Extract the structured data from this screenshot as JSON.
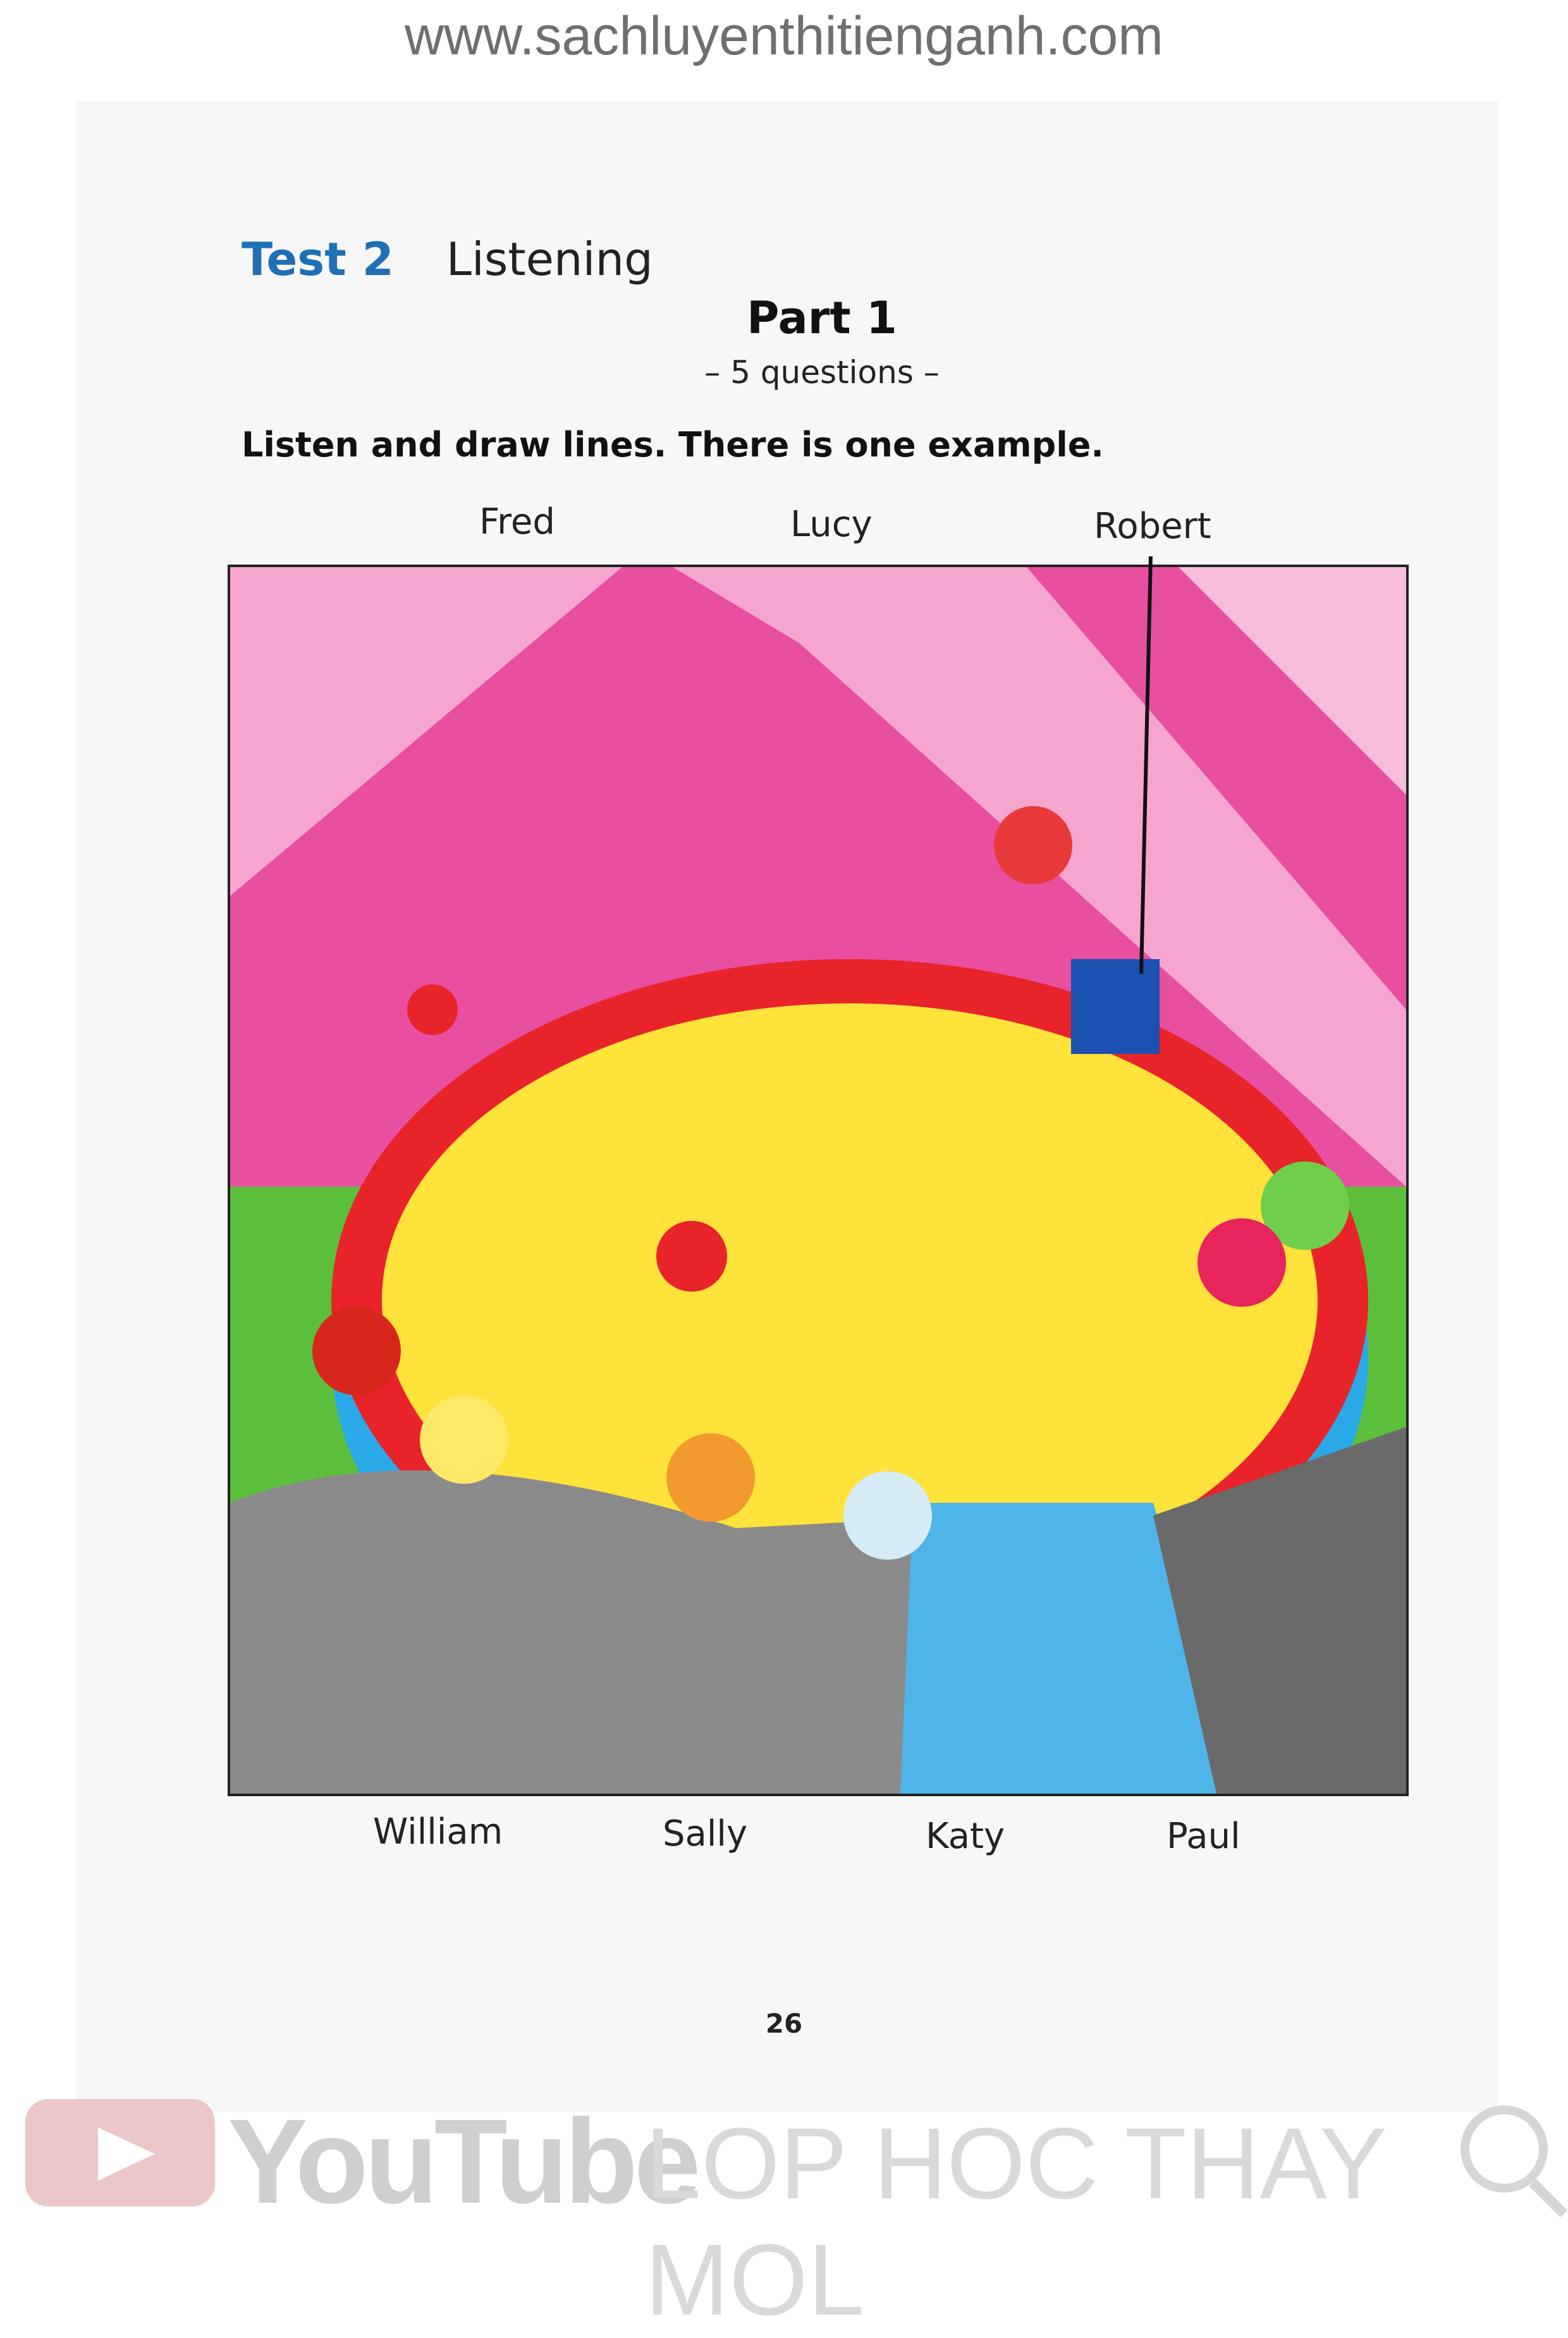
{
  "watermark": "www.sachluyenthitienganh.com",
  "header": {
    "test": "Test 2",
    "section": "Listening"
  },
  "part": {
    "title": "Part 1",
    "subtitle": "– 5 questions –"
  },
  "instruction": "Listen and draw lines. There is one example.",
  "names_top": [
    "Fred",
    "Lucy",
    "Robert"
  ],
  "names_bottom": [
    "William",
    "Sally",
    "Katy",
    "Paul"
  ],
  "page_number": "26",
  "footer": {
    "brand": "YouTube",
    "channel": "LOP HOC THAY MOL"
  },
  "colors": {
    "tent_pink": "#e84f9f",
    "ring_red": "#e8232a",
    "ring_yellow": "#ffe23a",
    "ring_blue": "#29a9e8",
    "floor_green": "#5cbf3c",
    "audience_gray": "#8a8a8a",
    "heading_blue": "#1f6fb5"
  }
}
